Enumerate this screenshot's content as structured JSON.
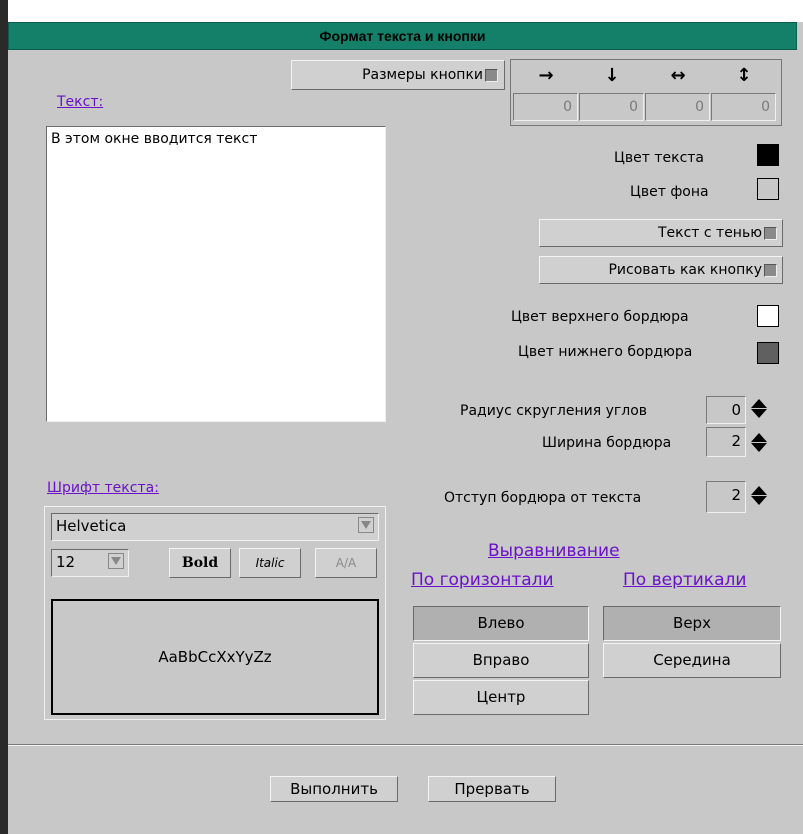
{
  "dialog": {
    "title": "Формат текста и кнопки"
  },
  "size_section": {
    "toggle_label": "Размеры кнопки",
    "directions": [
      {
        "icon": "arrow-right-icon",
        "glyph": "→",
        "value": "0"
      },
      {
        "icon": "arrow-down-icon",
        "glyph": "↓",
        "value": "0"
      },
      {
        "icon": "arrow-left-right-icon",
        "glyph": "↔",
        "value": "0"
      },
      {
        "icon": "arrow-up-down-icon",
        "glyph": "↕",
        "value": "0"
      }
    ]
  },
  "text_section": {
    "label": "Текст:",
    "value": "В этом окне вводится текст"
  },
  "colors": {
    "text_color_label": "Цвет текста",
    "text_color": "#000000",
    "bg_color_label": "Цвет фона",
    "bg_color": "#c8c8c8",
    "top_border_label": "Цвет верхнего бордюра",
    "top_border_color": "#ffffff",
    "bottom_border_label": "Цвет нижнего бордюра",
    "bottom_border_color": "#606060"
  },
  "toggles": {
    "shadow_label": "Текст с тенью",
    "as_button_label": "Рисовать как кнопку"
  },
  "spinners": {
    "corner_radius_label": "Радиус скругления углов",
    "corner_radius": "0",
    "border_width_label": "Ширина бордюра",
    "border_width": "2",
    "border_padding_label": "Отступ бордюра от текста",
    "border_padding": "2"
  },
  "font_section": {
    "label": "Шрифт текста:",
    "family": "Helvetica",
    "size": "12",
    "bold_label": "Bold",
    "italic_label": "Italic",
    "aa_label": "A/A",
    "preview_text": "AaBbCcXxYyZz"
  },
  "alignment": {
    "title": "Выравнивание",
    "horizontal_label": "По горизонтали",
    "vertical_label": "По вертикали",
    "horizontal_options": [
      "Влево",
      "Вправо",
      "Центр"
    ],
    "vertical_options": [
      "Верх",
      "Середина"
    ],
    "selected_horizontal": "Влево",
    "selected_vertical": "Верх"
  },
  "actions": {
    "ok_label": "Выполнить",
    "cancel_label": "Прервать"
  }
}
